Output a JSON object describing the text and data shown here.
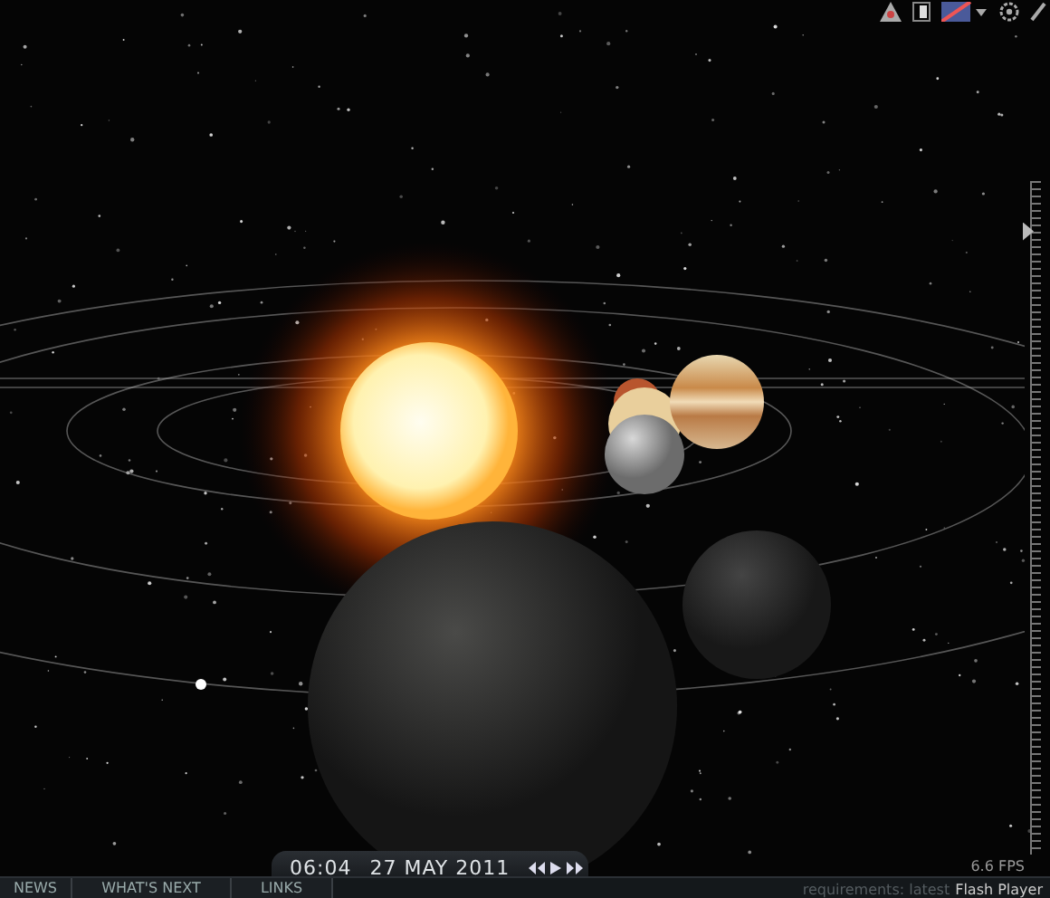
{
  "fps": "6.6 FPS",
  "zoom_slider": {
    "level": 0.94
  },
  "time_bar": {
    "time": "06:04",
    "date": "27 MAY 2011"
  },
  "nav_tabs": [
    {
      "label": "NEWS"
    },
    {
      "label": "WHAT'S NEXT"
    },
    {
      "label": "LINKS"
    }
  ],
  "requirements": {
    "text": "requirements: latest",
    "link": "Flash Player"
  }
}
